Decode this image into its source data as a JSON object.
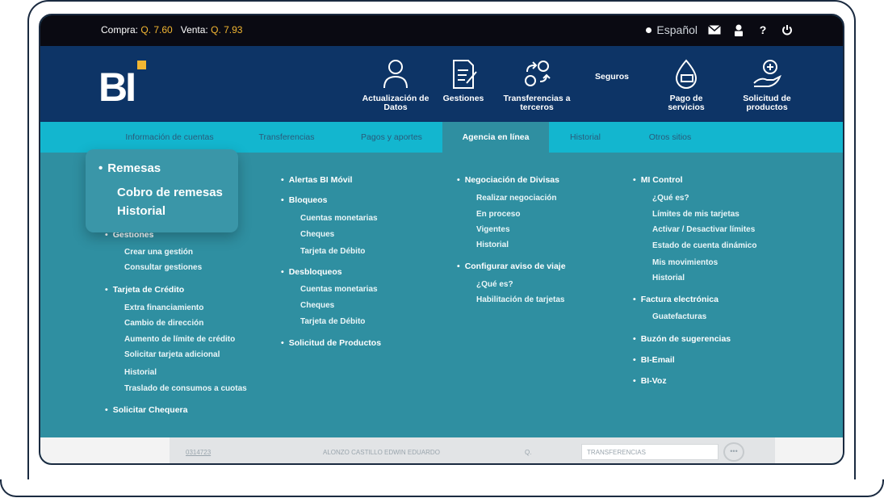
{
  "topbar": {
    "buy_label": "Compra:",
    "buy_value": "Q. 7.60",
    "sell_label": "Venta:",
    "sell_value": "Q. 7.93",
    "language": "Español",
    "icons": [
      "mail-icon",
      "user-icon",
      "help-icon",
      "power-icon"
    ],
    "help_glyph": "?",
    "power_glyph": "⏻"
  },
  "header": {
    "logo_text": "BI",
    "nav": [
      {
        "label": "Actualización de Datos",
        "icon": "person-icon"
      },
      {
        "label": "Gestiones",
        "icon": "document-edit-icon"
      },
      {
        "label": "Transferencias a terceros",
        "icon": "transfer-icon"
      },
      {
        "label": "Seguros",
        "icon": "none"
      },
      {
        "label": "Pago de servicios",
        "icon": "service-payment-icon"
      },
      {
        "label": "Solicitud de productos",
        "icon": "hand-plus-icon"
      }
    ]
  },
  "tabs": [
    {
      "label": "Información de cuentas"
    },
    {
      "label": "Transferencias"
    },
    {
      "label": "Pagos y aportes"
    },
    {
      "label": "Agencia en línea"
    },
    {
      "label": "Historial"
    },
    {
      "label": "Otros sitios"
    }
  ],
  "menu": {
    "col1": {
      "gestiones": {
        "title": "Gestiones",
        "items": [
          "Crear una gestión",
          "Consultar gestiones"
        ]
      },
      "tarjeta": {
        "title": "Tarjeta de Crédito",
        "items": [
          "Extra financiamiento",
          "Cambio de dirección",
          "Aumento de límite de crédito",
          "Solicitar tarjeta adicional",
          "Historial",
          "Traslado de consumos a cuotas"
        ]
      },
      "chequera": {
        "title": "Solicitar Chequera"
      }
    },
    "col2": {
      "alertas": {
        "title": "Alertas BI Móvil"
      },
      "bloqueos": {
        "title": "Bloqueos",
        "items": [
          "Cuentas monetarias",
          "Cheques",
          "Tarjeta de Débito"
        ]
      },
      "desbloqueos": {
        "title": "Desbloqueos",
        "items": [
          "Cuentas monetarias",
          "Cheques",
          "Tarjeta de Débito"
        ]
      },
      "solicitud": {
        "title": "Solicitud de Productos"
      }
    },
    "col3": {
      "divisas": {
        "title": "Negociación de Divisas",
        "items": [
          "Realizar negociación",
          "En proceso",
          "Vigentes",
          "Historial"
        ]
      },
      "viaje": {
        "title": "Configurar aviso de viaje",
        "items": [
          "¿Qué es?",
          "Habilitación de tarjetas"
        ]
      }
    },
    "col4": {
      "control": {
        "title": "MI Control",
        "items": [
          "¿Qué es?",
          "Límites de mis tarjetas",
          "Activar / Desactivar límites",
          "Estado de cuenta dinámico",
          "Mis movimientos",
          "Historial"
        ]
      },
      "factura": {
        "title": "Factura electrónica",
        "items": [
          "Guatefacturas"
        ]
      },
      "buzon": {
        "title": "Buzón de sugerencias"
      },
      "email": {
        "title": "BI-Email"
      },
      "voz": {
        "title": "BI-Voz"
      }
    }
  },
  "popover": {
    "title": "Remesas",
    "items": [
      "Cobro de remesas",
      "Historial"
    ]
  },
  "bottombar": {
    "account": "0314723",
    "name": "ALONZO CASTILLO EDWIN EDUARDO",
    "currency": "Q.",
    "field": "TRANSFERENCIAS",
    "button": "•••"
  },
  "colors": {
    "topbar": "#0a0a12",
    "header": "#0d3466",
    "tabs": "#13b6cf",
    "content": "#2f8fa1",
    "accent": "#f2b632"
  }
}
